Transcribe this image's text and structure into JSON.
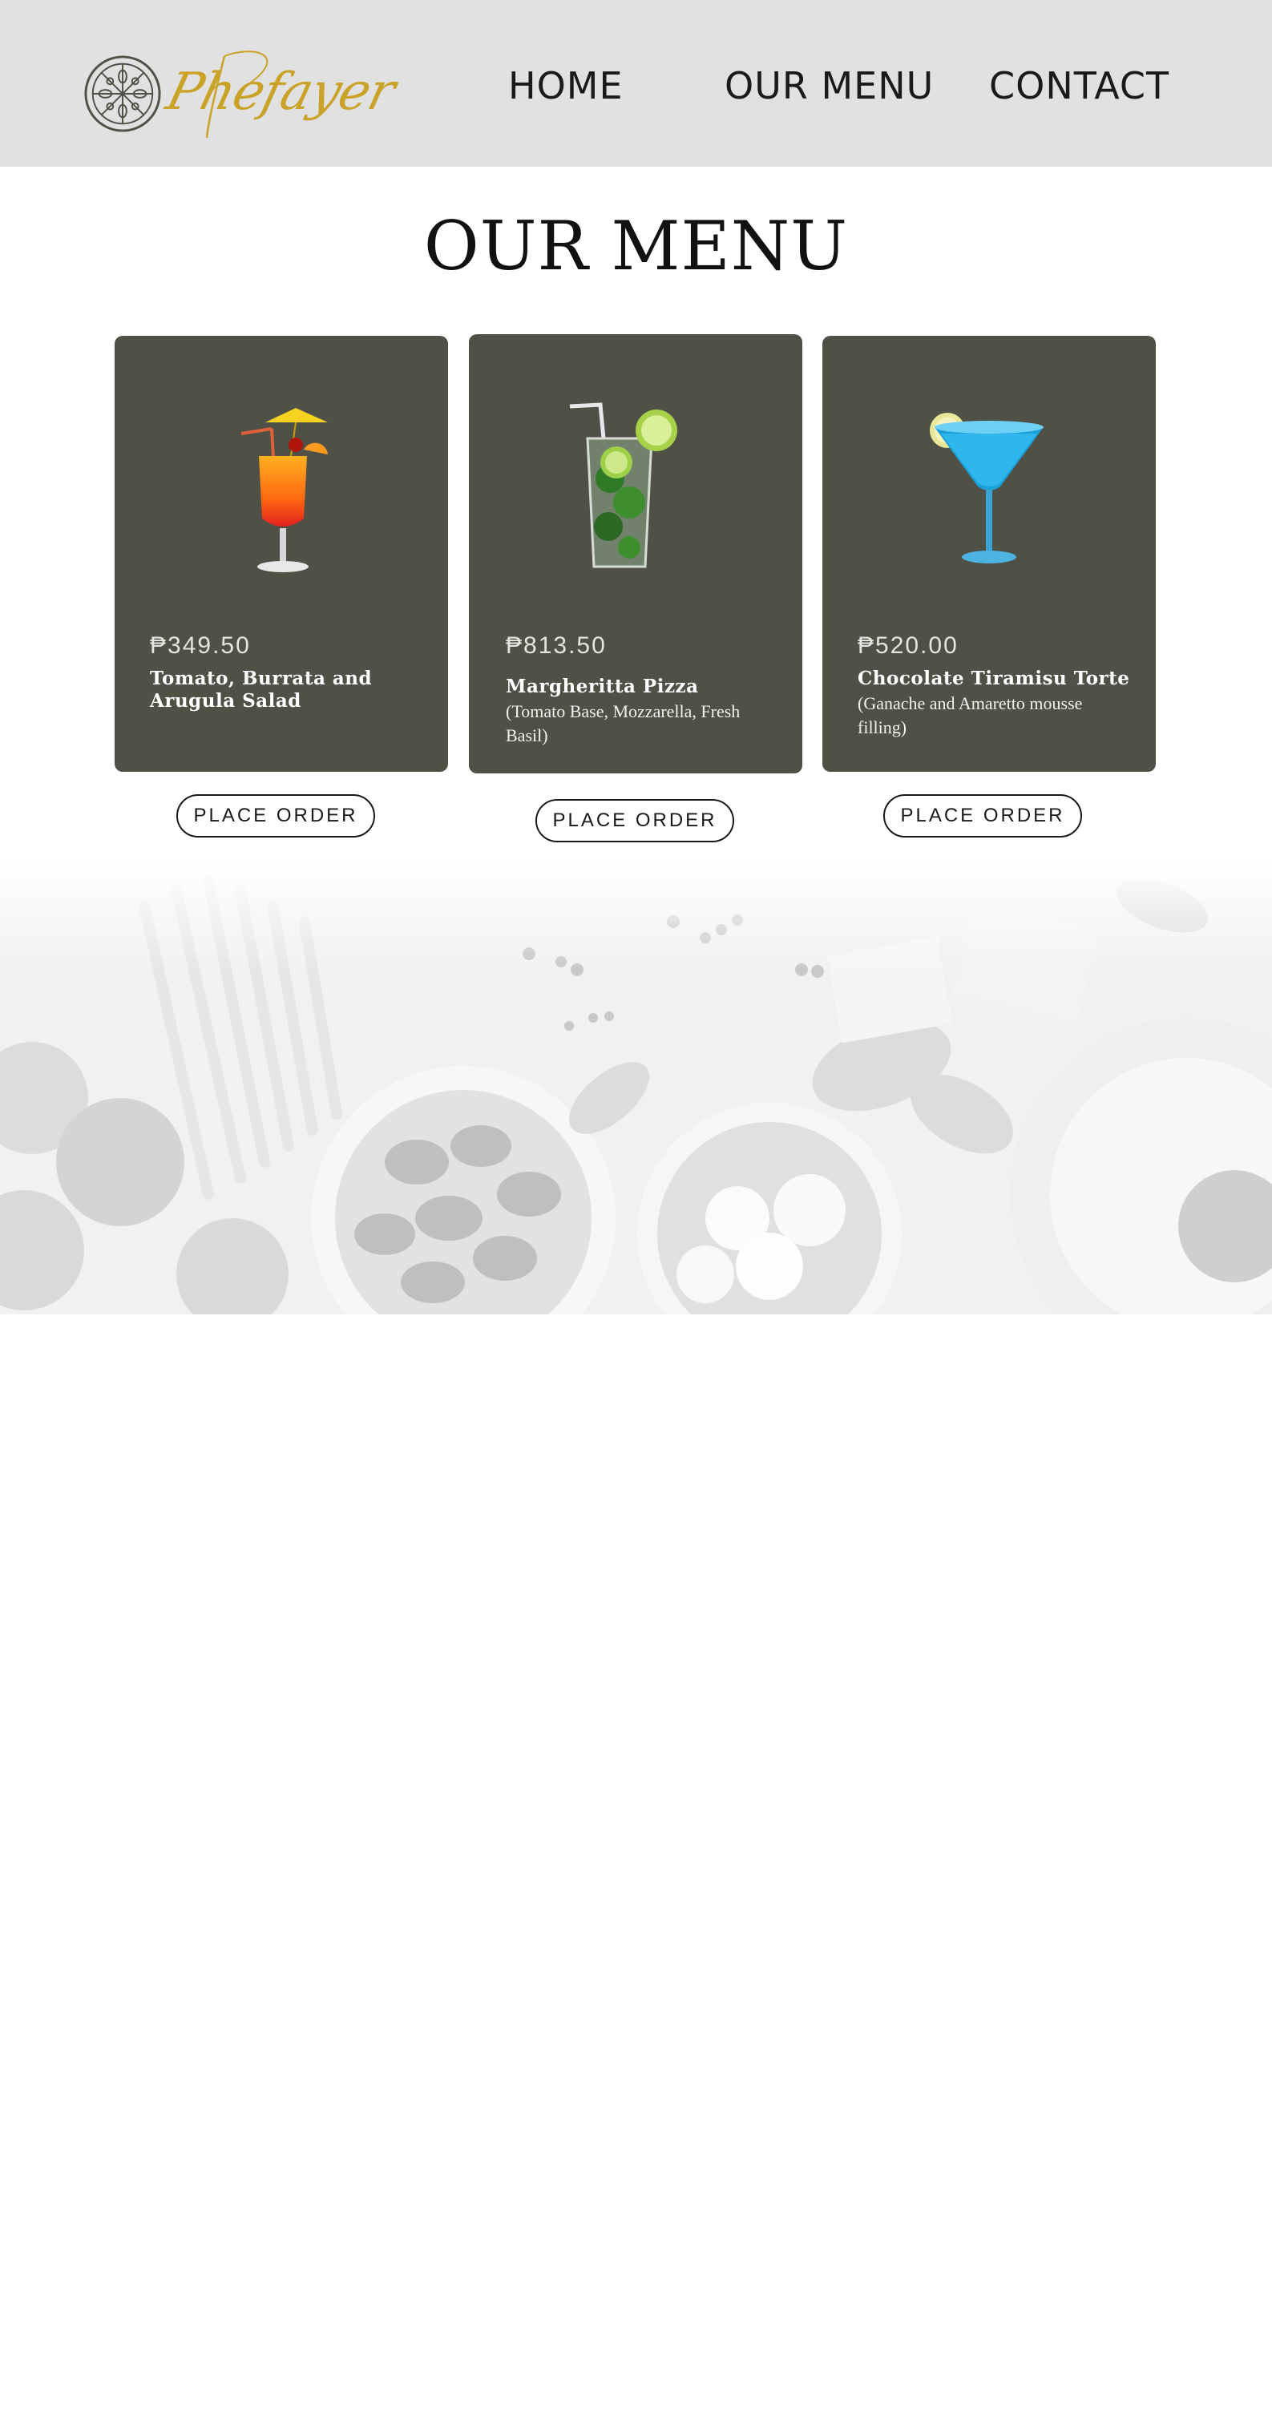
{
  "brand": {
    "name": "Phefayer",
    "color": "#c9a227",
    "emblem_icon": "pizza-wheel-icon"
  },
  "nav": {
    "items": [
      {
        "label": "HOME"
      },
      {
        "label": "OUR MENU"
      },
      {
        "label": "CONTACT"
      }
    ]
  },
  "page": {
    "title": "OUR MENU"
  },
  "menu": {
    "card_color": "#4f5147",
    "items": [
      {
        "price": "₱349.50",
        "name": "Tomato, Burrata and Arugula Salad",
        "description": "",
        "image": "tequila-sunrise-cocktail",
        "button": "PLACE ORDER"
      },
      {
        "price": "₱813.50",
        "name": "Margheritta Pizza",
        "description": "(Tomato Base, Mozzarella, Fresh Basil)",
        "image": "mojito-cocktail",
        "button": "PLACE ORDER"
      },
      {
        "price": "₱520.00",
        "name": "Chocolate Tiramisu Torte",
        "description": "(Ganache and Amaretto mousse filling)",
        "image": "blue-margarita-cocktail",
        "button": "PLACE ORDER"
      }
    ]
  },
  "banner": {
    "image": "faded-italian-ingredients-photo"
  }
}
